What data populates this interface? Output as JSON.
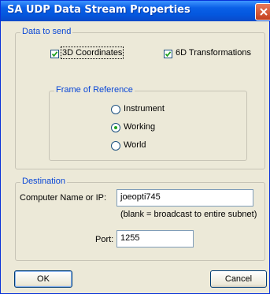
{
  "window": {
    "title": "SA UDP Data Stream Properties"
  },
  "data_to_send": {
    "label": "Data to send",
    "coords_label": "3D Coordinates",
    "coords_checked": true,
    "transforms_label": "6D Transformations",
    "transforms_checked": true
  },
  "frame_of_reference": {
    "label": "Frame of Reference",
    "options": [
      "Instrument",
      "Working",
      "World"
    ],
    "selected": "Working"
  },
  "destination": {
    "label": "Destination",
    "computer_label": "Computer Name or IP:",
    "computer_value": "joeopti745",
    "hint": "(blank = broadcast to entire subnet)",
    "port_label": "Port:",
    "port_value": "1255"
  },
  "buttons": {
    "ok": "OK",
    "cancel": "Cancel"
  }
}
